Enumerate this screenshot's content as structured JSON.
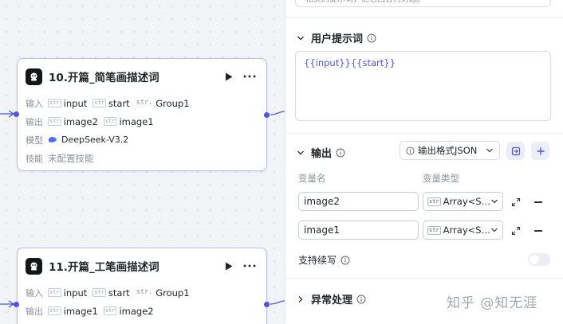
{
  "canvas": {
    "nodes": [
      {
        "title": "10.开篇_简笔画描述词",
        "input_label": "输入",
        "inputs": [
          {
            "type": "str",
            "name": "input"
          },
          {
            "type": "str",
            "name": "start"
          },
          {
            "type": "str.",
            "name": "Group1"
          }
        ],
        "output_label": "输出",
        "outputs": [
          {
            "type": "str",
            "name": "image2"
          },
          {
            "type": "str",
            "name": "image1"
          }
        ],
        "model_label": "模型",
        "model": "DeepSeek-V3.2",
        "skill_label": "技能",
        "skill_value": "未配置技能"
      },
      {
        "title": "11.开篇_工笔画描述词",
        "input_label": "输入",
        "inputs": [
          {
            "type": "str",
            "name": "input"
          },
          {
            "type": "str",
            "name": "start"
          },
          {
            "type": "str.",
            "name": "Group1"
          }
        ],
        "output_label": "输出",
        "outputs": [
          {
            "type": "str",
            "name": "image1"
          },
          {
            "type": "str",
            "name": "image2"
          }
        ]
      }
    ]
  },
  "panel": {
    "top_text": "相关的提示词，把它回答为对题。",
    "user_prompt": {
      "title": "用户提示词",
      "content": "{{input}}{{start}}"
    },
    "output": {
      "title": "输出",
      "format_label": "输出格式JSON",
      "col_name": "变量名",
      "col_type": "变量类型",
      "rows": [
        {
          "name": "image2",
          "type_tag": "str",
          "type": "Array<S…"
        },
        {
          "name": "image1",
          "type_tag": "str",
          "type": "Array<S…"
        }
      ],
      "continue_label": "支持续写"
    },
    "error": {
      "title": "异常处理"
    }
  },
  "watermark": "知乎 @知无涯",
  "colors": {
    "accent": "#4d53e8",
    "node_border": "#b8bdf5"
  }
}
